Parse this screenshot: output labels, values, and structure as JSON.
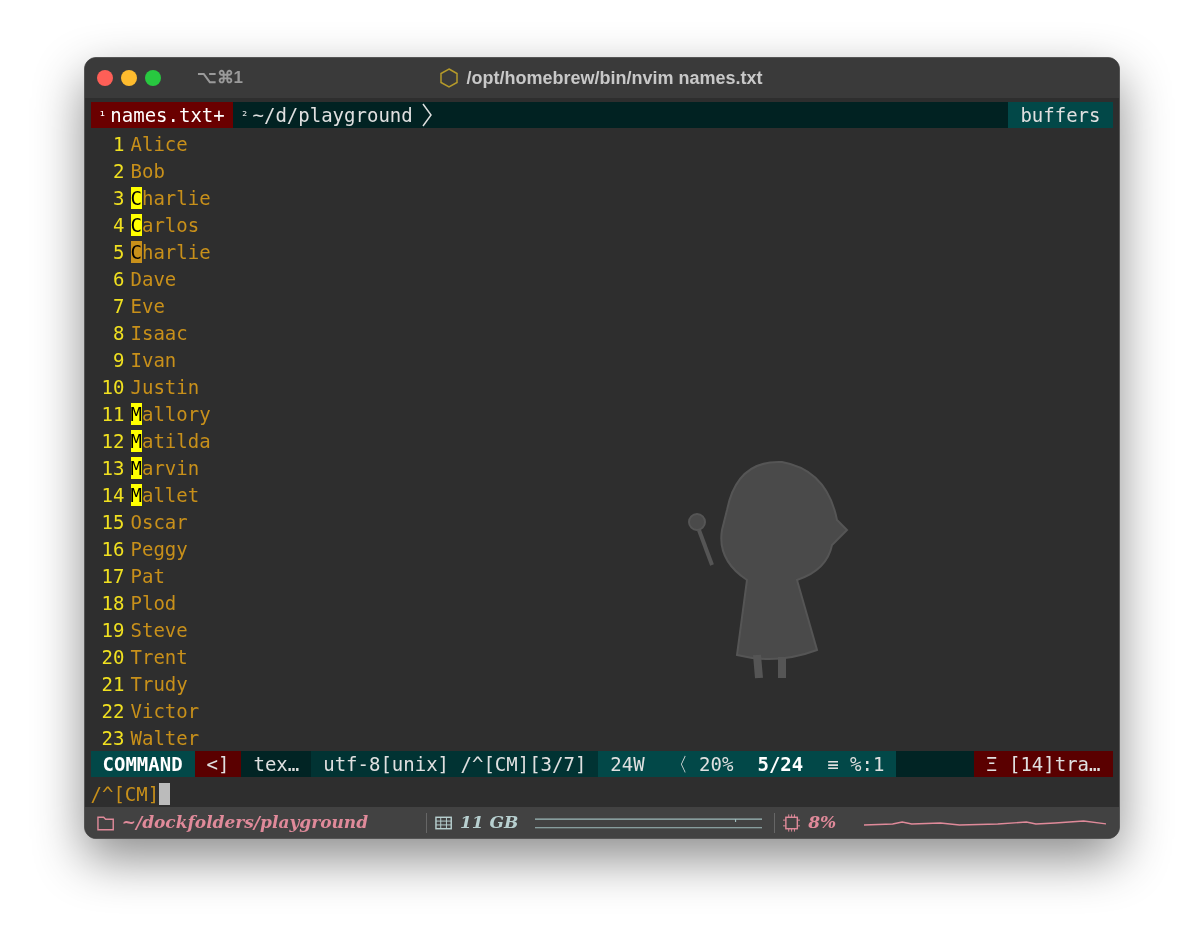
{
  "window": {
    "shortcut": "⌥⌘1",
    "title": "/opt/homebrew/bin/nvim names.txt"
  },
  "tabline": {
    "tabs": [
      {
        "index": "¹",
        "label": "names.txt+",
        "selected": true
      },
      {
        "index": "²",
        "label": "~/d/playground",
        "selected": false
      }
    ],
    "right": "buffers"
  },
  "lines": [
    {
      "number": "1",
      "text": "Alice"
    },
    {
      "number": "2",
      "text": "Bob"
    },
    {
      "number": "3",
      "lead": "C",
      "current": false,
      "text": "harlie"
    },
    {
      "number": "4",
      "lead": "C",
      "current": false,
      "text": "arlos"
    },
    {
      "number": "5",
      "lead": "C",
      "current": true,
      "text": "harlie"
    },
    {
      "number": "6",
      "text": "Dave"
    },
    {
      "number": "7",
      "text": "Eve"
    },
    {
      "number": "8",
      "text": "Isaac"
    },
    {
      "number": "9",
      "text": "Ivan"
    },
    {
      "number": "10",
      "text": "Justin"
    },
    {
      "number": "11",
      "lead": "M",
      "current": false,
      "text": "allory"
    },
    {
      "number": "12",
      "lead": "M",
      "current": false,
      "text": "atilda"
    },
    {
      "number": "13",
      "lead": "M",
      "current": false,
      "text": "arvin"
    },
    {
      "number": "14",
      "lead": "M",
      "current": false,
      "text": "allet"
    },
    {
      "number": "15",
      "text": "Oscar"
    },
    {
      "number": "16",
      "text": "Peggy"
    },
    {
      "number": "17",
      "text": "Pat"
    },
    {
      "number": "18",
      "text": "Plod"
    },
    {
      "number": "19",
      "text": "Steve"
    },
    {
      "number": "20",
      "text": "Trent"
    },
    {
      "number": "21",
      "text": "Trudy"
    },
    {
      "number": "22",
      "text": "Victor"
    },
    {
      "number": "23",
      "text": "Walter"
    }
  ],
  "statusline": {
    "mode": "COMMAND",
    "segments": [
      {
        "kind": "warn",
        "text": "<]"
      },
      {
        "kind": "dark",
        "text": "tex…"
      },
      {
        "kind": "mid",
        "text": "utf-8[unix] /^[CM][3/7]"
      },
      {
        "kind": "light",
        "text": "24W"
      },
      {
        "kind": "light",
        "text": "〈 20%"
      },
      {
        "kind": "bold",
        "text": "5/24"
      },
      {
        "kind": "light",
        "text": "≡ %:1"
      },
      {
        "kind": "warn",
        "text": "Ξ [14]tra…"
      }
    ]
  },
  "cmdline": "/^[CM]",
  "bottom_bar": {
    "path": "~/dockfolders/playground",
    "memory": "11 GB",
    "cpu": "8%"
  }
}
